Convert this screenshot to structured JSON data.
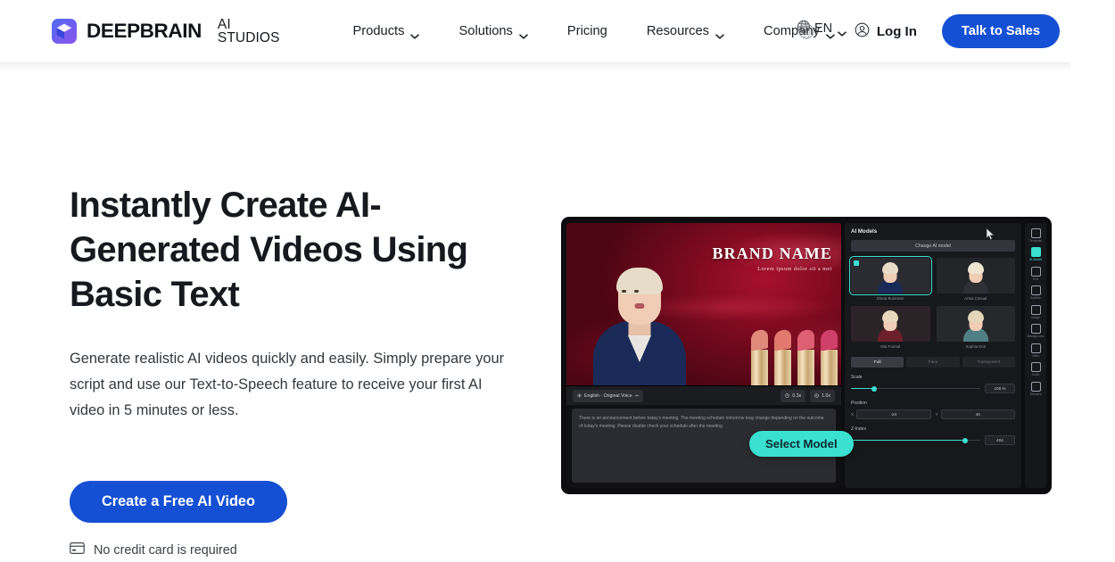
{
  "header": {
    "brand": {
      "name": "DEEPBRAIN",
      "suffix": "AI STUDIOS",
      "icon": "cube-logo-icon"
    },
    "nav": [
      {
        "label": "Products",
        "has_caret": true
      },
      {
        "label": "Solutions",
        "has_caret": true
      },
      {
        "label": "Pricing",
        "has_caret": false
      },
      {
        "label": "Resources",
        "has_caret": true
      },
      {
        "label": "Company",
        "has_caret": true
      }
    ],
    "language": {
      "label": "EN",
      "icon": "globe-icon"
    },
    "login": {
      "label": "Log In",
      "icon": "account-circle-icon"
    },
    "cta": {
      "label": "Talk to Sales",
      "color": "#1550d4"
    }
  },
  "hero": {
    "title": "Instantly Create AI-Generated Videos Using Basic Text",
    "subtitle": "Generate realistic AI videos quickly and easily. Simply prepare your script and use our Text-to-Speech feature to receive your first AI video in 5 minutes or less.",
    "cta": {
      "label": "Create a Free AI Video",
      "color": "#1550d4"
    },
    "note": {
      "label": "No credit card is required",
      "icon": "credit-card-icon"
    }
  },
  "app_preview": {
    "canvas": {
      "brand_headline": "BRAND NAME",
      "brand_subline": "Lorem ipsum dolor sit a met"
    },
    "toolbar": {
      "voice": "English - Original Voice",
      "pause": "0.3s",
      "speed": "1.0x"
    },
    "script": "There is an announcement before today's meeting. The meeting schedule tomorrow may change depending on the outcome of today's meeting. Please double check your schedule after the meeting.",
    "tooltip": {
      "label": "Select Model",
      "color": "#3ae0d0"
    },
    "panel": {
      "title": "AI Models",
      "change_button": "Change AI model",
      "models": [
        {
          "name": "Elena Business",
          "selected": true
        },
        {
          "name": "Anna Casual",
          "selected": false
        },
        {
          "name": "Mia Formal",
          "selected": false
        },
        {
          "name": "Sophia Knit",
          "selected": false
        }
      ],
      "segments": [
        {
          "label": "Full",
          "active": true
        },
        {
          "label": "Face",
          "active": false
        },
        {
          "label": "Transparent",
          "active": false
        }
      ],
      "controls": [
        {
          "label": "Scale",
          "type": "slider",
          "value": "100 %",
          "percent": 18
        },
        {
          "label": "Position",
          "type": "xy",
          "x": "-24",
          "y": "40"
        },
        {
          "label": "Z-Index",
          "type": "slider",
          "value": "404",
          "percent": 88
        }
      ]
    },
    "rail": [
      {
        "label": "Template",
        "icon": "template-icon",
        "active": false
      },
      {
        "label": "AI Model",
        "icon": "ai-model-icon",
        "active": true
      },
      {
        "label": "Text",
        "icon": "text-icon",
        "active": false
      },
      {
        "label": "Subtitle",
        "icon": "subtitle-icon",
        "active": false
      },
      {
        "label": "Image",
        "icon": "image-icon",
        "active": false
      },
      {
        "label": "Background",
        "icon": "background-icon",
        "active": false
      },
      {
        "label": "Video",
        "icon": "video-icon",
        "active": false
      },
      {
        "label": "Audio",
        "icon": "audio-icon",
        "active": false
      },
      {
        "label": "Element",
        "icon": "element-icon",
        "active": false
      }
    ]
  }
}
